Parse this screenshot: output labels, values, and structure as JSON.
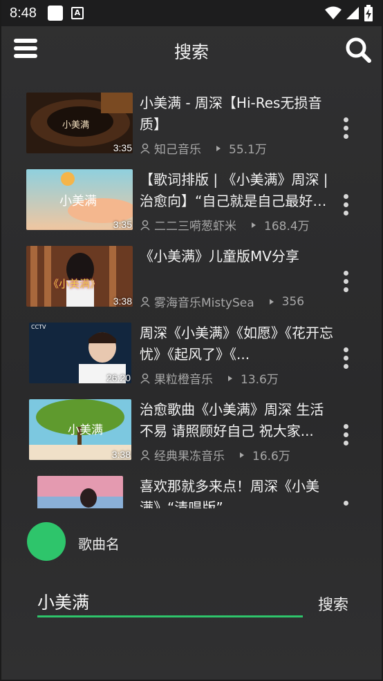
{
  "status_bar": {
    "time": "8:48",
    "a_badge": "A"
  },
  "app_bar": {
    "title": "搜索"
  },
  "results": [
    {
      "title": "小美满 - 周深【Hi-Res无损音质】",
      "channel": "知己音乐",
      "views": "55.1万",
      "duration": "3:35",
      "thumb_text": "小美满"
    },
    {
      "title": "【歌词排版 | 《小美满》周深 | 治愈向】“自己就是自己最好的...",
      "channel": "二二三嗬葱虾米",
      "views": "168.4万",
      "duration": "3:35",
      "thumb_text": "小美满"
    },
    {
      "title": "《小美满》儿童版MV分享",
      "channel": "雾海音乐MistySea",
      "views": "356",
      "duration": "3:38",
      "thumb_text": "《小美满》"
    },
    {
      "title": "周深《小美满》《如愿》《花开忘忧》《起风了》《...",
      "channel": "果粒橙音乐",
      "views": "13.6万",
      "duration": "26:20",
      "thumb_text": "CCTV"
    },
    {
      "title": "治愈歌曲《小美满》周深 生活不易 请照顾好自己 祝大家...",
      "channel": "经典果冻音乐",
      "views": "16.6万",
      "duration": "3:38",
      "thumb_text": "小美满"
    },
    {
      "title": "喜欢那就多来点！周深《小美满》“清唱版”",
      "channel": "",
      "views": "",
      "duration": "",
      "thumb_text": ""
    }
  ],
  "now_playing": {
    "label": "歌曲名"
  },
  "search": {
    "value": "小美满",
    "button_label": "搜索"
  },
  "colors": {
    "accent": "#2ec56b",
    "background": "#2b2b2c"
  }
}
